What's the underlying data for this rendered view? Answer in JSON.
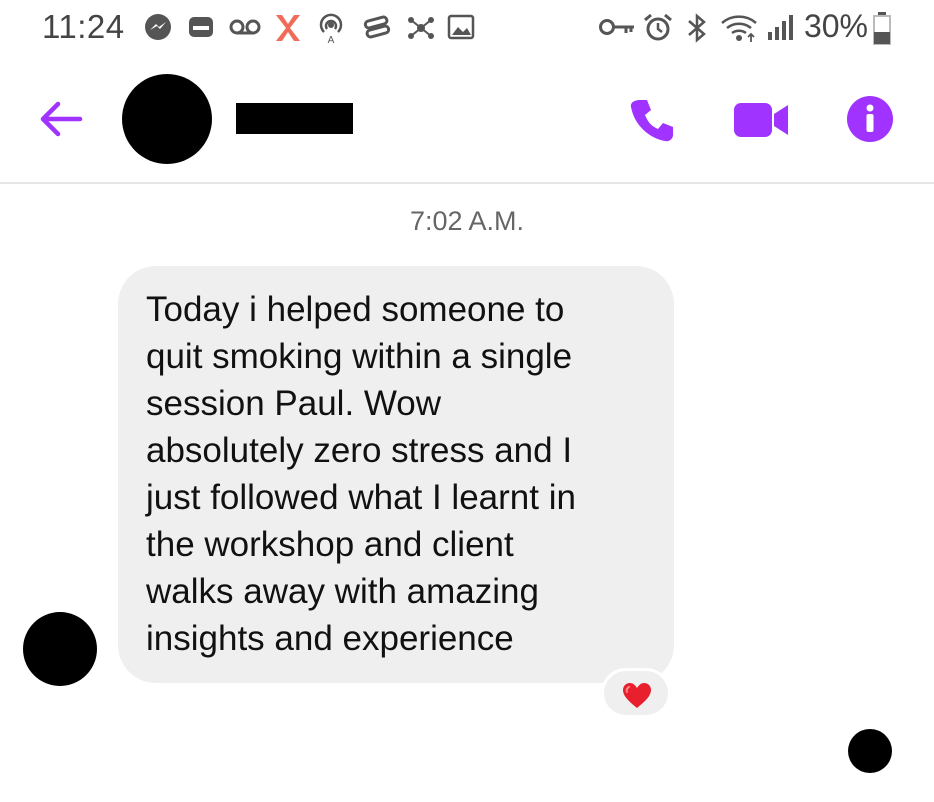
{
  "status_bar": {
    "time": "11:24",
    "battery": "30%",
    "icons": [
      "messenger-icon",
      "card-icon",
      "voicemail-icon",
      "app-x-icon",
      "hotspot-icon",
      "sync-icon",
      "network-icon",
      "image-icon",
      "key-icon",
      "alarm-icon",
      "bluetooth-icon",
      "wifi-icon",
      "signal-icon",
      "battery-icon"
    ]
  },
  "header": {
    "icons": [
      "back-arrow-icon",
      "phone-icon",
      "video-icon",
      "info-icon"
    ],
    "accent_color": "#a033ff"
  },
  "conversation": {
    "timestamp": "7:02 A.M.",
    "message": {
      "lines": [
        "Today i helped someone to",
        "quit smoking within a single",
        "session Paul. Wow",
        "absolutely zero stress and I",
        "just followed what I learnt in",
        "the workshop and client",
        "walks away with amazing",
        "insights and experience"
      ],
      "reaction": "❤️"
    }
  }
}
